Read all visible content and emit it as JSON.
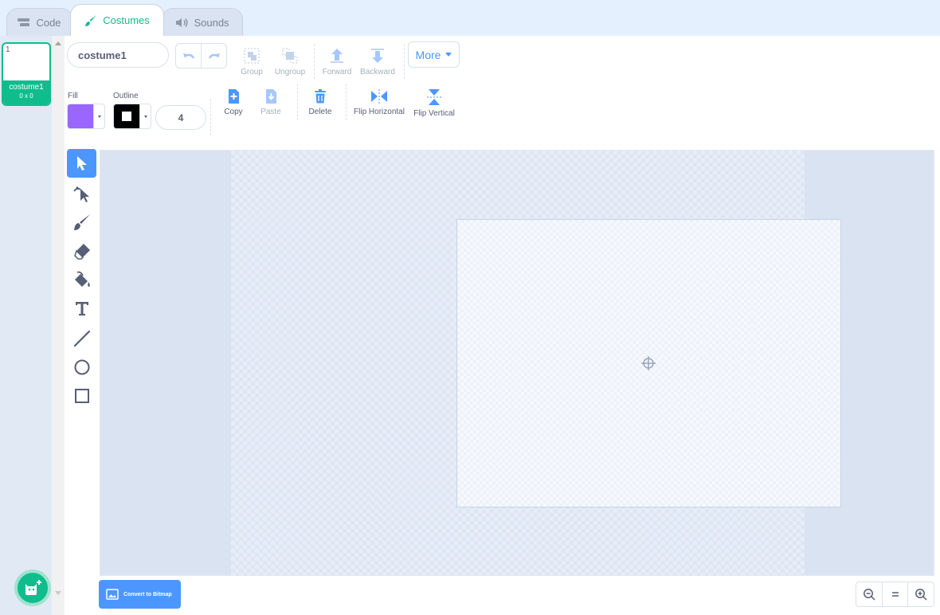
{
  "tabs": [
    {
      "label": "Code",
      "icon": "code-icon"
    },
    {
      "label": "Costumes",
      "icon": "paintbrush-icon"
    },
    {
      "label": "Sounds",
      "icon": "speaker-icon"
    }
  ],
  "costumes": [
    {
      "number": "1",
      "name": "costume1",
      "size": "0 x 0"
    }
  ],
  "editor": {
    "costume_name": "costume1",
    "group_label": "Group",
    "ungroup_label": "Ungroup",
    "forward_label": "Forward",
    "backward_label": "Backward",
    "more_label": "More",
    "fill_label": "Fill",
    "outline_label": "Outline",
    "outline_width": "4",
    "copy_label": "Copy",
    "paste_label": "Paste",
    "delete_label": "Delete",
    "flip_horizontal_label": "Flip Horizontal",
    "flip_vertical_label": "Flip Vertical",
    "convert_label": "Convert to Bitmap"
  },
  "colors": {
    "fill": "#9966ff",
    "outline": "#000000",
    "accent": "#4c97ff",
    "costume_selected": "#0fbd8c"
  },
  "tools": [
    "select-tool",
    "reshape-tool",
    "brush-tool",
    "eraser-tool",
    "fill-tool",
    "text-tool",
    "line-tool",
    "circle-tool",
    "rectangle-tool"
  ],
  "selected_tool": "select-tool"
}
